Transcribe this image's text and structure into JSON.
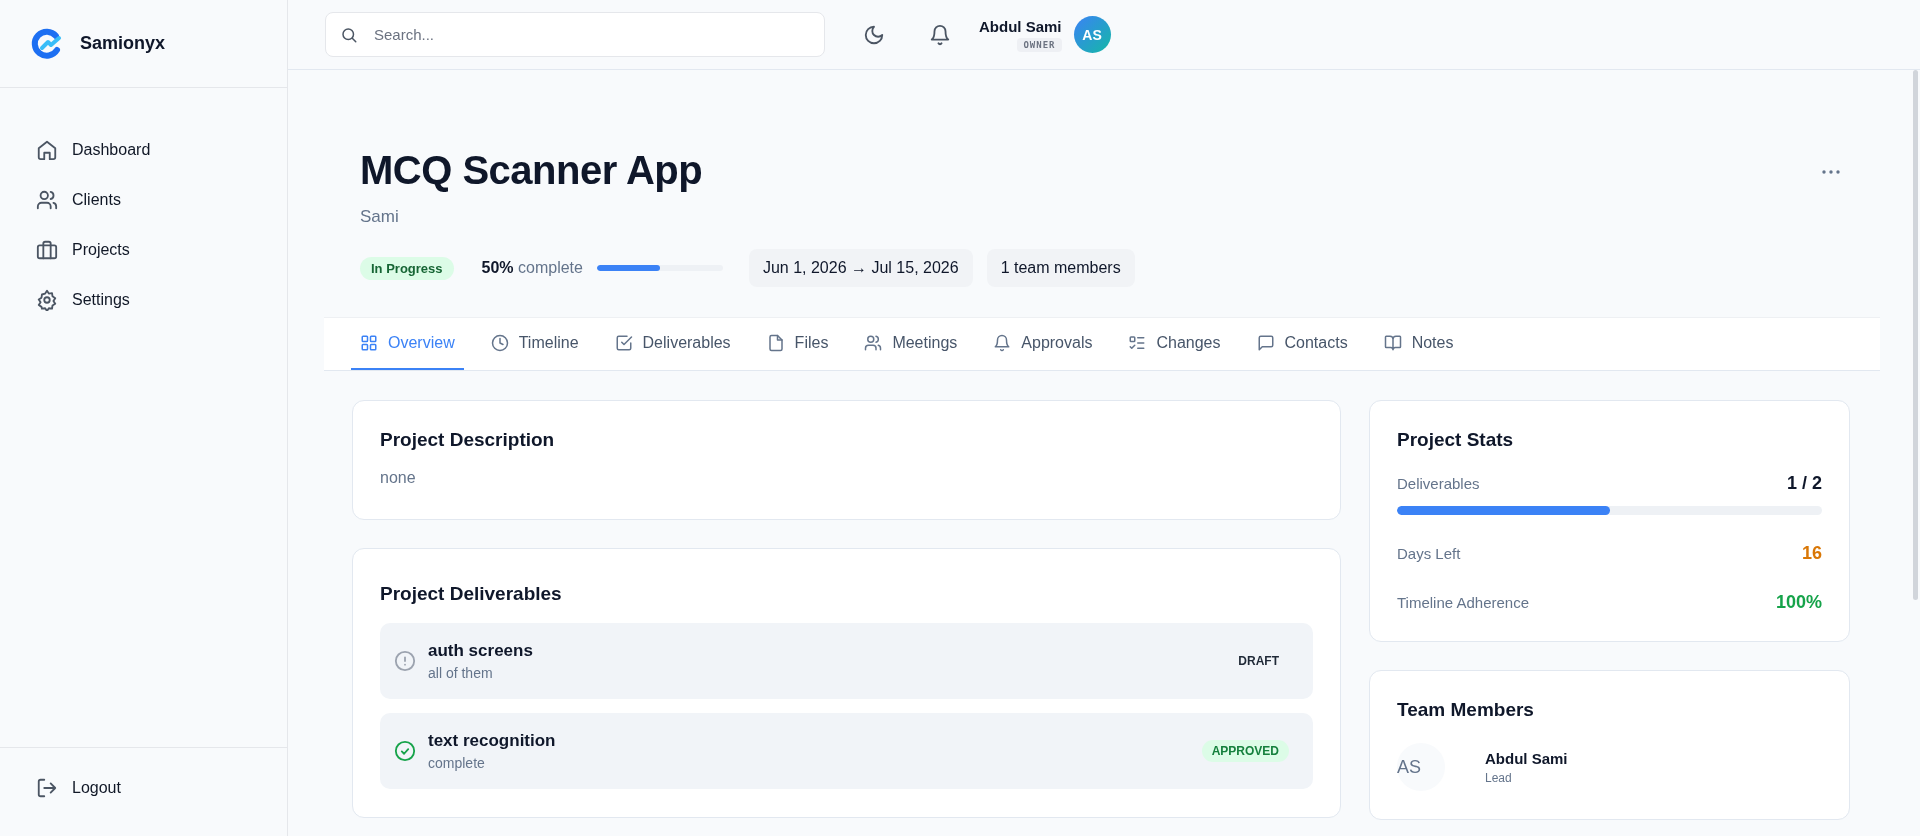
{
  "brand": {
    "name": "Samionyx"
  },
  "nav": [
    {
      "label": "Dashboard",
      "selected": false
    },
    {
      "label": "Clients",
      "selected": false
    },
    {
      "label": "Projects",
      "selected": false
    },
    {
      "label": "Settings",
      "selected": false
    }
  ],
  "logout": {
    "label": "Logout"
  },
  "search": {
    "placeholder": "Search..."
  },
  "user": {
    "name": "Abdul Sami",
    "role": "OWNER",
    "initials": "AS"
  },
  "project": {
    "title": "MCQ Scanner App",
    "client": "Sami",
    "status": "In Progress",
    "percent": "50%",
    "percent_suffix": "complete",
    "level": 0.5,
    "dates": "Jun 1, 2026 → Jul 15, 2026",
    "team": "1 team members"
  },
  "tabs": [
    {
      "label": "Overview",
      "selected": true
    },
    {
      "label": "Timeline",
      "selected": false
    },
    {
      "label": "Deliverables",
      "selected": false
    },
    {
      "label": "Files",
      "selected": false
    },
    {
      "label": "Meetings",
      "selected": false
    },
    {
      "label": "Approvals",
      "selected": false
    },
    {
      "label": "Changes",
      "selected": false
    },
    {
      "label": "Contacts",
      "selected": false
    },
    {
      "label": "Notes",
      "selected": false
    }
  ],
  "description": {
    "title": "Project Description",
    "text": "none"
  },
  "deliverables": {
    "title": "Project Deliverables",
    "items": [
      {
        "name": "auth screens",
        "note": "all of them",
        "status": "DRAFT",
        "kind": "draft"
      },
      {
        "name": "text recognition",
        "note": "complete",
        "status": "APPROVED",
        "kind": "approved"
      }
    ]
  },
  "stats": {
    "title": "Project Stats",
    "deliverables": {
      "label": "Deliverables",
      "value": "1 / 2",
      "level": 0.5
    },
    "items": [
      {
        "label": "Days Left",
        "value": "16",
        "color": "#d97706"
      },
      {
        "label": "Timeline Adherence",
        "value": "100%",
        "color": "#16a34a"
      }
    ]
  },
  "team": {
    "title": "Team Members",
    "members": [
      {
        "initials": "AS",
        "name": "Abdul Sami",
        "role": "Lead"
      }
    ]
  }
}
